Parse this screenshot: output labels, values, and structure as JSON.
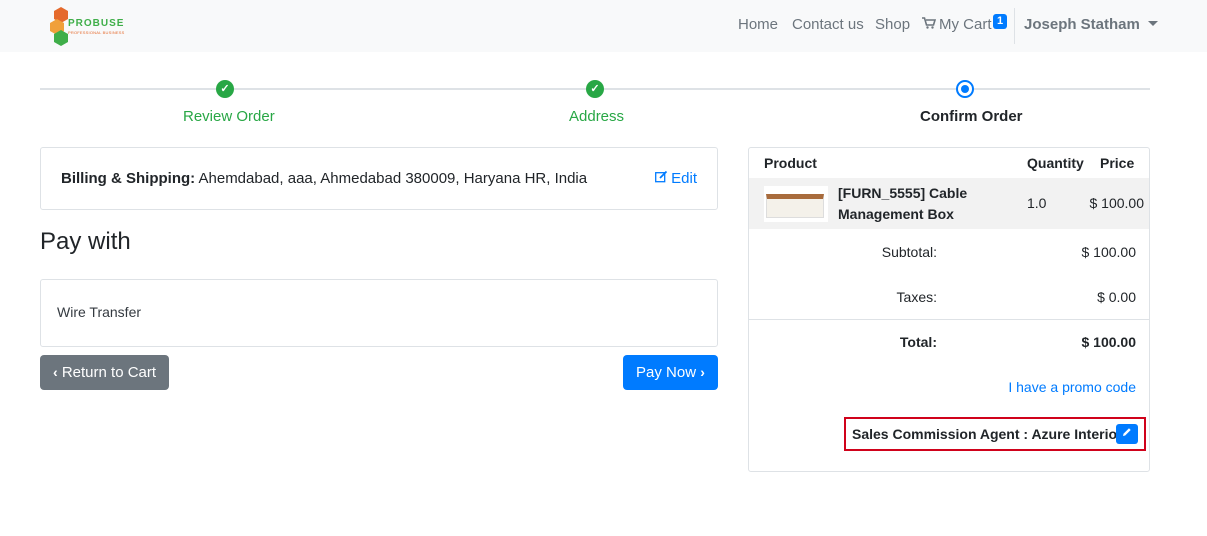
{
  "navbar": {
    "logo_text": "PROBUSE",
    "logo_sub": "PROFESSIONAL BUSINESS",
    "home": "Home",
    "contact": "Contact us",
    "shop": "Shop",
    "cart": "My Cart",
    "cart_count": "1",
    "user": "Joseph Statham",
    "icons": {
      "cart": "shopping-cart-icon",
      "user_menu": "chevron-down-icon"
    }
  },
  "progress": {
    "steps": [
      {
        "label": "Review Order",
        "state": "done"
      },
      {
        "label": "Address",
        "state": "done"
      },
      {
        "label": "Confirm Order",
        "state": "current"
      }
    ],
    "colors": {
      "done": "#28a745",
      "current": "#007bff"
    }
  },
  "billing": {
    "label": "Billing & Shipping:",
    "address": "Ahemdabad, aaa, Ahmedabad 380009, Haryana HR, India",
    "edit": "Edit"
  },
  "payment": {
    "title": "Pay with",
    "method": "Wire Transfer",
    "return_button": "Return to Cart",
    "pay_button": "Pay Now"
  },
  "summary": {
    "headers": {
      "product": "Product",
      "quantity": "Quantity",
      "price": "Price"
    },
    "items": [
      {
        "name": "[FURN_5555] Cable Management Box",
        "quantity": "1.0",
        "price": "$ 100.00"
      }
    ],
    "subtotal_label": "Subtotal:",
    "subtotal": "$ 100.00",
    "taxes_label": "Taxes:",
    "taxes": "$ 0.00",
    "total_label": "Total:",
    "total": "$ 100.00",
    "promo": "I have a promo code",
    "agent": "Sales Commission Agent : Azure Interior"
  },
  "colors": {
    "primary": "#007bff",
    "secondary": "#6c757d",
    "success": "#28a745",
    "highlight": "#d0021b"
  }
}
